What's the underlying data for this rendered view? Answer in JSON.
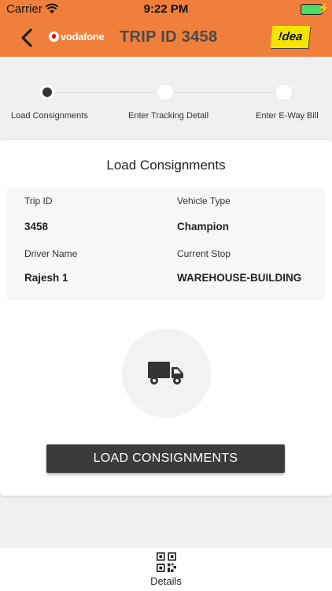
{
  "status_bar": {
    "carrier": "Carrier",
    "time": "9:22 PM",
    "battery_color": "#4cd964"
  },
  "header": {
    "title": "TRIP ID 3458",
    "left_logo_text": "vodafone",
    "right_logo_text": "!dea",
    "background": "#f07f3c"
  },
  "stepper": {
    "steps": [
      {
        "label": "Load Consignments",
        "active": true
      },
      {
        "label": "Enter Tracking Detail",
        "active": false
      },
      {
        "label": "Enter E-Way Bill",
        "active": false
      }
    ]
  },
  "card": {
    "title": "Load Consignments",
    "trip_id_label": "Trip ID",
    "trip_id_value": "3458",
    "vehicle_type_label": "Vehicle Type",
    "vehicle_type_value": "Champion",
    "driver_name_label": "Driver Name",
    "driver_name_value": "Rajesh 1",
    "current_stop_label": "Current Stop",
    "current_stop_value": "WAREHOUSE-BUILDING",
    "icon": "truck-icon",
    "button_label": "LOAD CONSIGNMENTS"
  },
  "tab_bar": {
    "details_label": "Details",
    "details_icon": "qr-code-icon"
  }
}
